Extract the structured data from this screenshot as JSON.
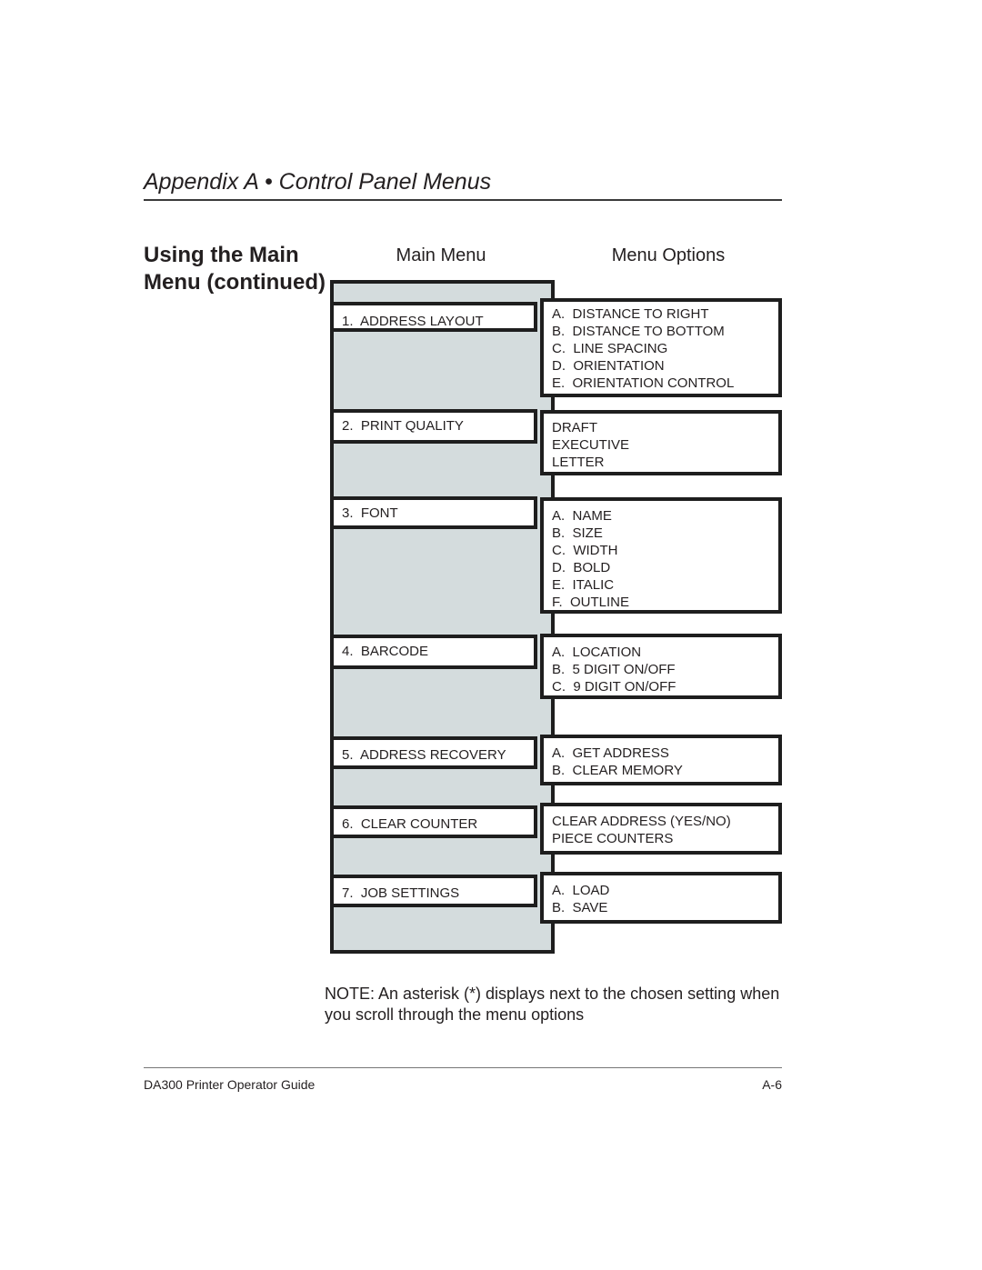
{
  "header": {
    "title": "Appendix A • Control Panel Menus"
  },
  "section": {
    "title": "Using the Main Menu (continued)"
  },
  "columns": {
    "main": "Main Menu",
    "options": "Menu Options"
  },
  "menu": [
    {
      "label": "1.  ADDRESS LAYOUT",
      "options": [
        "A.  DISTANCE TO RIGHT",
        "B.  DISTANCE TO BOTTOM",
        "C.  LINE SPACING",
        "D.  ORIENTATION",
        "E.  ORIENTATION CONTROL"
      ]
    },
    {
      "label": "2.  PRINT QUALITY",
      "options": [
        "DRAFT",
        "EXECUTIVE",
        "LETTER"
      ]
    },
    {
      "label": "3.  FONT",
      "options": [
        "A.  NAME",
        "B.  SIZE",
        "C.  WIDTH",
        "D.  BOLD",
        "E.  ITALIC",
        "F.  OUTLINE"
      ]
    },
    {
      "label": "4.  BARCODE",
      "options": [
        "A.  LOCATION",
        "B.  5 DIGIT ON/OFF",
        "C.  9 DIGIT ON/OFF"
      ]
    },
    {
      "label": "5.  ADDRESS RECOVERY",
      "options": [
        "A.  GET ADDRESS",
        "B.  CLEAR MEMORY"
      ]
    },
    {
      "label": "6.  CLEAR COUNTER",
      "options": [
        "CLEAR ADDRESS (YES/NO)",
        "PIECE COUNTERS"
      ]
    },
    {
      "label": "7.  JOB SETTINGS",
      "options": [
        "A.  LOAD",
        "B.  SAVE"
      ]
    }
  ],
  "note": "NOTE: An asterisk (*) displays next to the chosen setting when you scroll through the menu options",
  "footer": {
    "guide": "DA300 Printer Operator Guide",
    "page": "A-6"
  }
}
